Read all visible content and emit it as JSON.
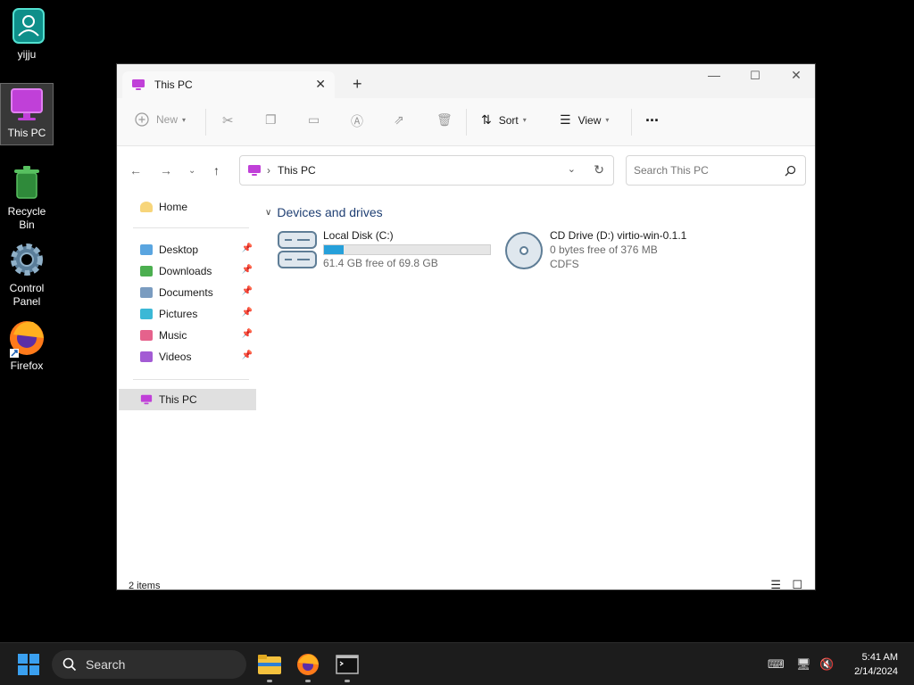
{
  "desktop": {
    "icons": [
      {
        "label": "yijju"
      },
      {
        "label": "This PC"
      },
      {
        "label": "Recycle Bin"
      },
      {
        "label": "Control Panel"
      },
      {
        "label": "Firefox"
      }
    ]
  },
  "window": {
    "tab_title": "This PC",
    "toolbar": {
      "new_label": "New",
      "sort_label": "Sort",
      "view_label": "View",
      "more_label": "..."
    },
    "address": {
      "path": "This PC"
    },
    "search": {
      "placeholder": "Search This PC"
    },
    "sidebar": {
      "home": "Home",
      "items": [
        {
          "label": "Desktop",
          "color": "#5aa5e0"
        },
        {
          "label": "Downloads",
          "color": "#4caf50"
        },
        {
          "label": "Documents",
          "color": "#7a9cc0"
        },
        {
          "label": "Pictures",
          "color": "#3bb8d6"
        },
        {
          "label": "Music",
          "color": "#e5628c"
        },
        {
          "label": "Videos",
          "color": "#a35bd4"
        }
      ],
      "this_pc": "This PC"
    },
    "content": {
      "section_title": "Devices and drives",
      "drives": [
        {
          "name": "Local Disk (C:)",
          "free_text": "61.4 GB free of 69.8 GB",
          "used_fraction": 0.12
        },
        {
          "name": "CD Drive (D:) virtio-win-0.1.1",
          "free_text": "0 bytes free of 376 MB",
          "fs": "CDFS"
        }
      ]
    },
    "status": {
      "items_count": "2 items"
    }
  },
  "taskbar": {
    "search_label": "Search",
    "time": "5:41 AM",
    "date": "2/14/2024"
  },
  "colors": {
    "accent": "#26a0da",
    "thispc_icon": "#c040d8",
    "folder_home": "#f7d57a"
  }
}
